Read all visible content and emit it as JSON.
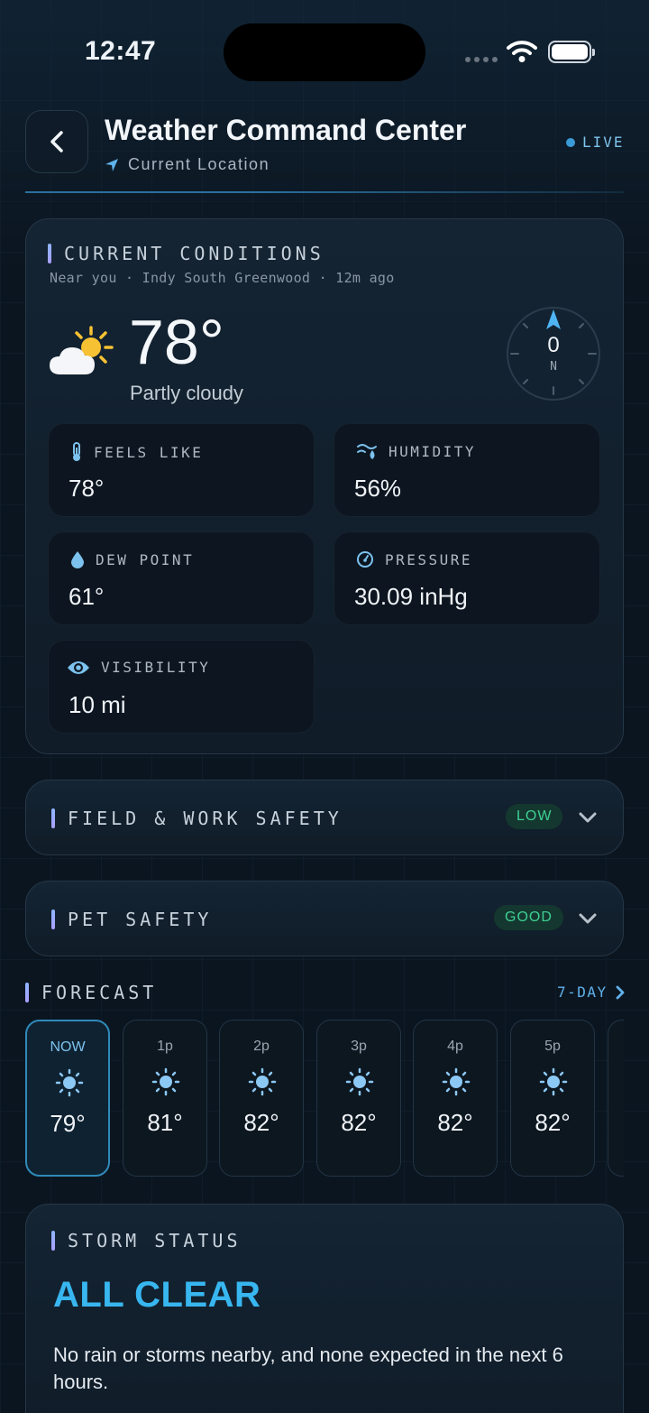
{
  "status_bar": {
    "time": "12:47"
  },
  "header": {
    "title": "Weather Command Center",
    "subtitle": "Current Location",
    "live_label": "LIVE"
  },
  "current": {
    "section_label": "CURRENT CONDITIONS",
    "meta": "Near you · Indy South Greenwood · 12m ago",
    "temperature": "78°",
    "condition": "Partly cloudy",
    "wind_speed": "0",
    "wind_dir": "N",
    "tiles": [
      {
        "label": "FEELS LIKE",
        "value": "78°",
        "icon": "thermometer-icon"
      },
      {
        "label": "HUMIDITY",
        "value": "56%",
        "icon": "humidity-icon"
      },
      {
        "label": "DEW POINT",
        "value": "61°",
        "icon": "droplet-icon"
      },
      {
        "label": "PRESSURE",
        "value": "30.09 inHg",
        "icon": "gauge-icon"
      },
      {
        "label": "VISIBILITY",
        "value": "10 mi",
        "icon": "eye-icon"
      }
    ]
  },
  "field_safety": {
    "label": "FIELD & WORK SAFETY",
    "badge": "LOW"
  },
  "pet_safety": {
    "label": "PET SAFETY",
    "badge": "GOOD"
  },
  "forecast": {
    "label": "FORECAST",
    "link": "7-DAY",
    "hours": [
      {
        "time": "NOW",
        "temp": "79°"
      },
      {
        "time": "1p",
        "temp": "81°"
      },
      {
        "time": "2p",
        "temp": "82°"
      },
      {
        "time": "3p",
        "temp": "82°"
      },
      {
        "time": "4p",
        "temp": "82°"
      },
      {
        "time": "5p",
        "temp": "82°"
      }
    ]
  },
  "storm": {
    "label": "STORM STATUS",
    "status": "ALL CLEAR",
    "description": "No rain or storms nearby, and none expected in the next 6 hours."
  },
  "colors": {
    "accent": "#38b6f0",
    "good": "#3fcf94",
    "bar": "#8fb6ff"
  }
}
